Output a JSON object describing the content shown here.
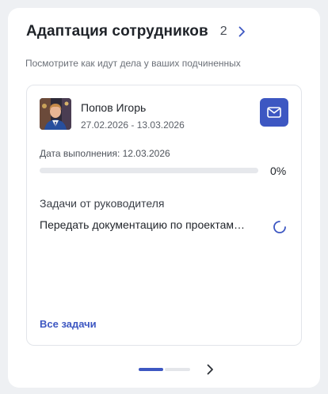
{
  "widget": {
    "title": "Адаптация сотрудников",
    "count": "2",
    "subtitle": "Посмотрите как идут дела у ваших подчиненных"
  },
  "employee": {
    "name": "Попов Игорь",
    "period": "27.02.2026 - 13.03.2026",
    "due_label": "Дата выполнения: 12.03.2026",
    "progress_fraction": 0,
    "progress_text": "0%"
  },
  "tasks": {
    "heading": "Задачи от руководителя",
    "items": [
      {
        "text": "Передать документацию по проектам…",
        "status_icon": "loading-spinner-icon"
      }
    ],
    "all_link": "Все задачи"
  },
  "pager": {
    "pages": 2,
    "current": 1
  },
  "colors": {
    "accent": "#3d57c2",
    "track": "#e6e8ec",
    "background": "#eef0f3"
  },
  "icons": {
    "header_next": "chevron-right-icon",
    "mail": "mail-icon",
    "pager_next": "chevron-right-icon"
  }
}
